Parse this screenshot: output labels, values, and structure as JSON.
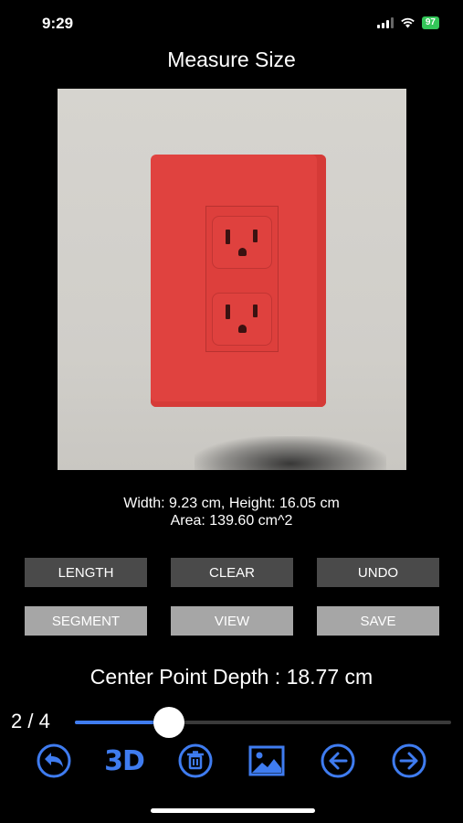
{
  "status_bar": {
    "time": "9:29",
    "battery": "97"
  },
  "header": {
    "title": "Measure Size"
  },
  "measurement": {
    "dimensions": "Width: 9.23 cm, Height: 16.05 cm",
    "area": "Area: 139.60 cm^2"
  },
  "buttons": {
    "length": "LENGTH",
    "clear": "CLEAR",
    "undo": "UNDO",
    "segment": "SEGMENT",
    "view": "VIEW",
    "save": "SAVE"
  },
  "depth": {
    "text": "Center Point Depth : 18.77 cm"
  },
  "slider": {
    "page_label": "2 / 4",
    "current": 2,
    "total": 4,
    "fraction": 0.25
  },
  "toolbar": {
    "items": [
      {
        "name": "back-arrow-icon"
      },
      {
        "name": "3d-view",
        "label": "3D"
      },
      {
        "name": "trash-icon"
      },
      {
        "name": "image-icon"
      },
      {
        "name": "arrow-left-icon"
      },
      {
        "name": "arrow-right-icon"
      }
    ]
  },
  "colors": {
    "accent": "#3f7cf0",
    "button_dark": "#4a4a4a",
    "button_light": "#a6a6a6",
    "outlet": "#e0423f"
  }
}
